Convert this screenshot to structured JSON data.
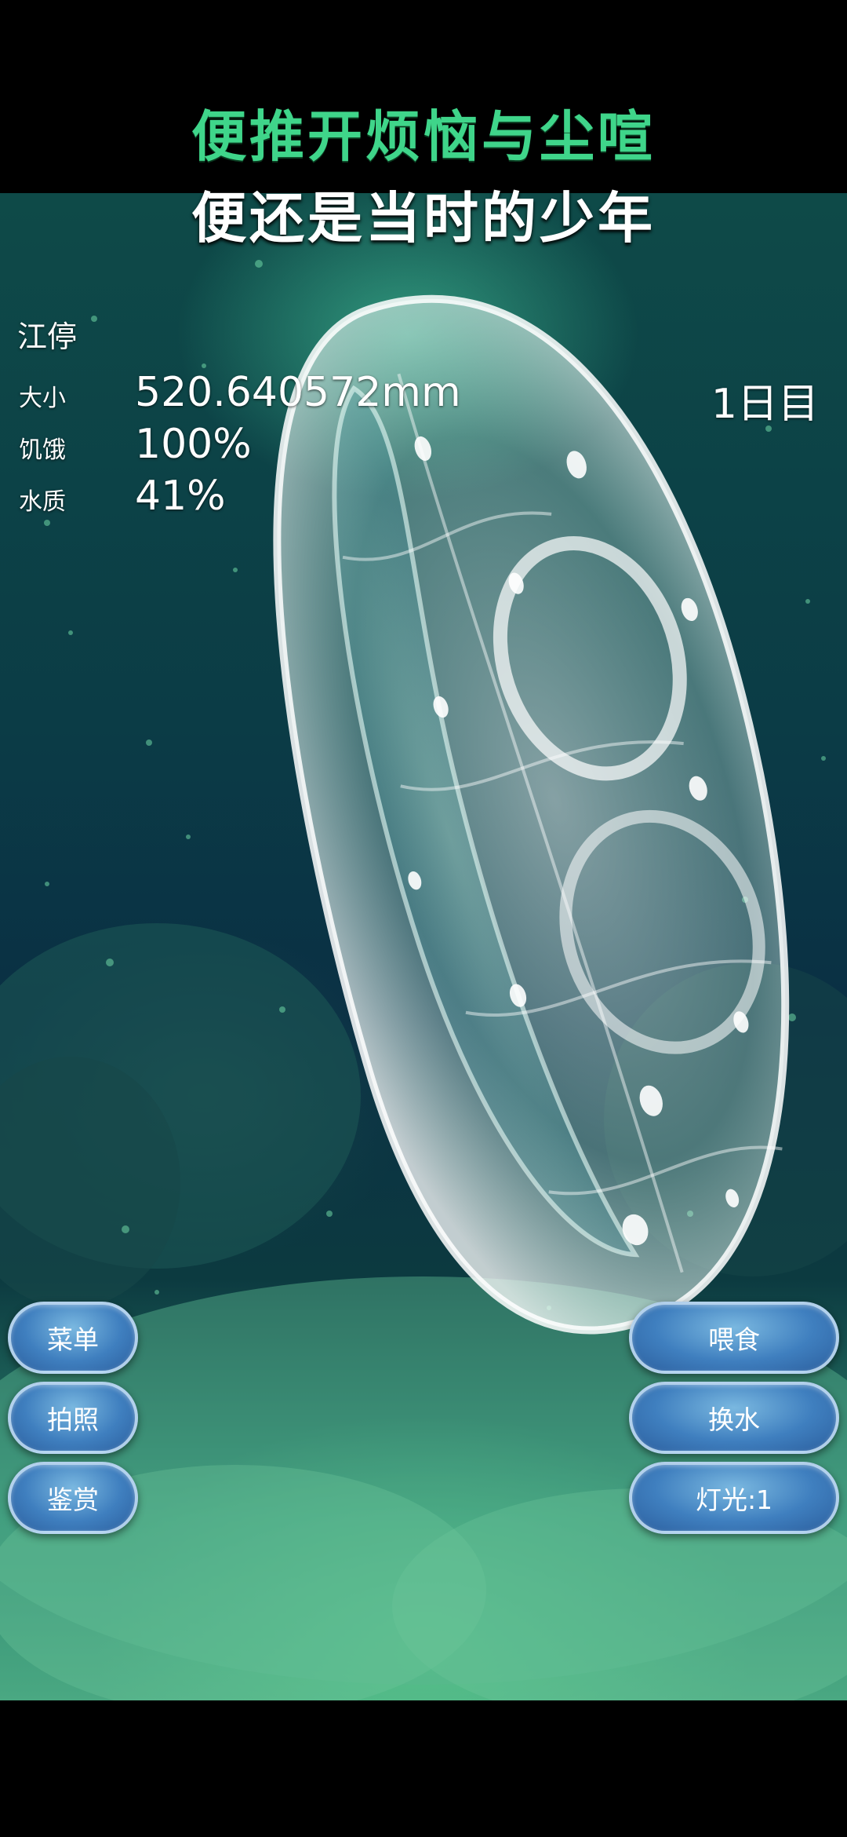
{
  "lyrics": {
    "line1": "便推开烦恼与尘喧",
    "line2": "便还是当时的少年"
  },
  "pet": {
    "name": "江停",
    "size_label": "大小",
    "size_value": "520.640572mm",
    "hunger_label": "饥饿",
    "hunger_value": "100%",
    "water_label": "水质",
    "water_value": "41%",
    "day": "1日目"
  },
  "buttons": {
    "menu": "菜单",
    "photo": "拍照",
    "appreciate": "鉴赏",
    "feed": "喂食",
    "change_water": "换水",
    "light": "灯光:1"
  }
}
